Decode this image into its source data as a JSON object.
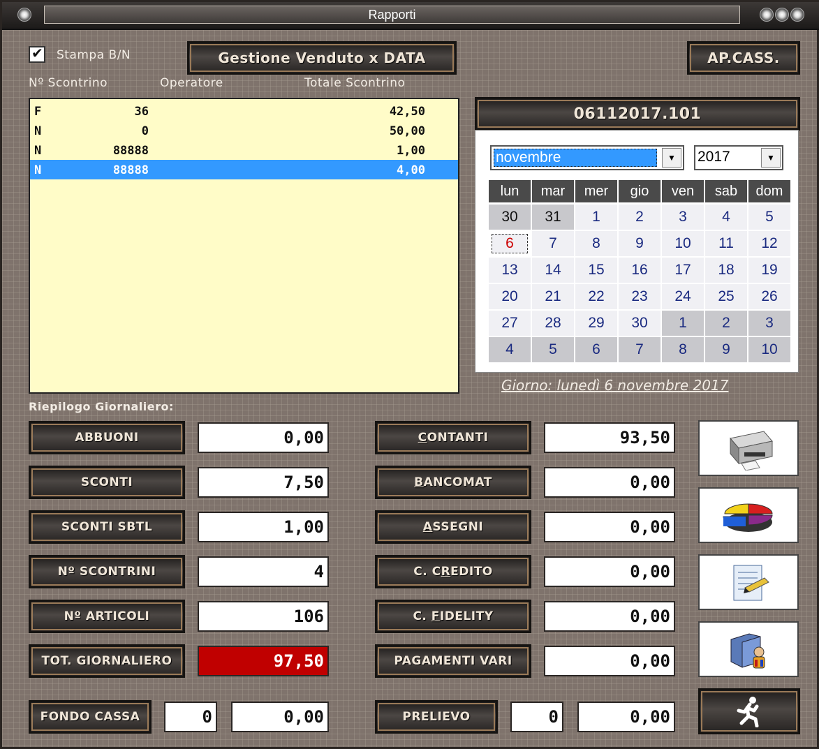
{
  "window": {
    "title": "Rapporti"
  },
  "header": {
    "stampa_label": "Stampa B/N",
    "stampa_checked": true,
    "gestione_button": "Gestione Venduto x DATA",
    "apcass_button": "AP.CASS."
  },
  "list": {
    "columns": [
      "Nº Scontrino",
      "Operatore",
      "Totale Scontrino"
    ],
    "rows": [
      {
        "type": "F",
        "number": "36",
        "total": "42,50"
      },
      {
        "type": "N",
        "number": "0",
        "total": "50,00"
      },
      {
        "type": "N",
        "number": "88888",
        "total": "1,00"
      },
      {
        "type": "N",
        "number": "88888",
        "total": "4,00"
      }
    ]
  },
  "calendar": {
    "code_button": "06112017.101",
    "month": "novembre",
    "year": "2017",
    "weekdays": [
      "lun",
      "mar",
      "mer",
      "gio",
      "ven",
      "sab",
      "dom"
    ],
    "weeks": [
      [
        "30",
        "31",
        "1",
        "2",
        "3",
        "4",
        "5"
      ],
      [
        "6",
        "7",
        "8",
        "9",
        "10",
        "11",
        "12"
      ],
      [
        "13",
        "14",
        "15",
        "16",
        "17",
        "18",
        "19"
      ],
      [
        "20",
        "21",
        "22",
        "23",
        "24",
        "25",
        "26"
      ],
      [
        "27",
        "28",
        "29",
        "30",
        "1",
        "2",
        "3"
      ],
      [
        "4",
        "5",
        "6",
        "7",
        "8",
        "9",
        "10"
      ]
    ],
    "selected_day": "6",
    "day_label": "Giorno: lunedì 6 novembre 2017"
  },
  "summary": {
    "title": "Riepilogo Giornaliero:",
    "left": [
      {
        "label": "ABBUONI",
        "value": "0,00"
      },
      {
        "label": "SCONTI",
        "value": "7,50"
      },
      {
        "label": "SCONTI SBTL",
        "value": "1,00"
      },
      {
        "label": "Nº SCONTRINI",
        "value": "4"
      },
      {
        "label": "Nº ARTICOLI",
        "value": "106"
      },
      {
        "label": "TOT. GIORNALIERO",
        "value": "97,50"
      }
    ],
    "right": [
      {
        "label_u": "C",
        "label_rest": "ONTANTI",
        "value": "93,50"
      },
      {
        "label_u": "B",
        "label_rest": "ANCOMAT",
        "value": "0,00"
      },
      {
        "label_u": "A",
        "label_rest": "SSEGNI",
        "value": "0,00"
      },
      {
        "label_pre": "C. C",
        "label_u": "R",
        "label_rest": "EDITO",
        "value": "0,00"
      },
      {
        "label_pre": "C. ",
        "label_u": "F",
        "label_rest": "IDELITY",
        "value": "0,00"
      },
      {
        "label": "PAGAMENTI VARI",
        "value": "0,00"
      }
    ],
    "fondo_cassa": {
      "label": "FONDO CASSA",
      "count": "0",
      "value": "0,00"
    },
    "prelievo": {
      "label": "PRELIEVO",
      "count": "0",
      "value": "0,00"
    }
  },
  "icons": [
    "printer-icon",
    "pie-chart-icon",
    "notepad-pencil-icon",
    "user-folder-icon",
    "exit-running-man-icon"
  ]
}
